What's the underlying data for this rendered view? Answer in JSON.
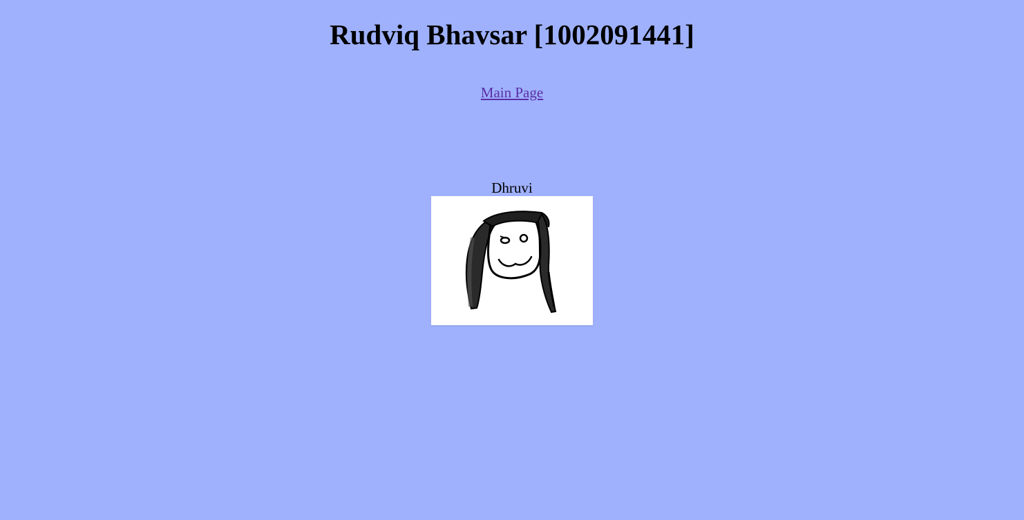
{
  "page": {
    "title": "Rudviq Bhavsar [1002091441]",
    "background_color": "#9fb1fd"
  },
  "nav": {
    "main_page_link": "Main Page",
    "link_color": "#5a2ea6"
  },
  "gallery": {
    "caption": "Dhruvi",
    "image_icon": "hand-drawn-face-icon"
  }
}
